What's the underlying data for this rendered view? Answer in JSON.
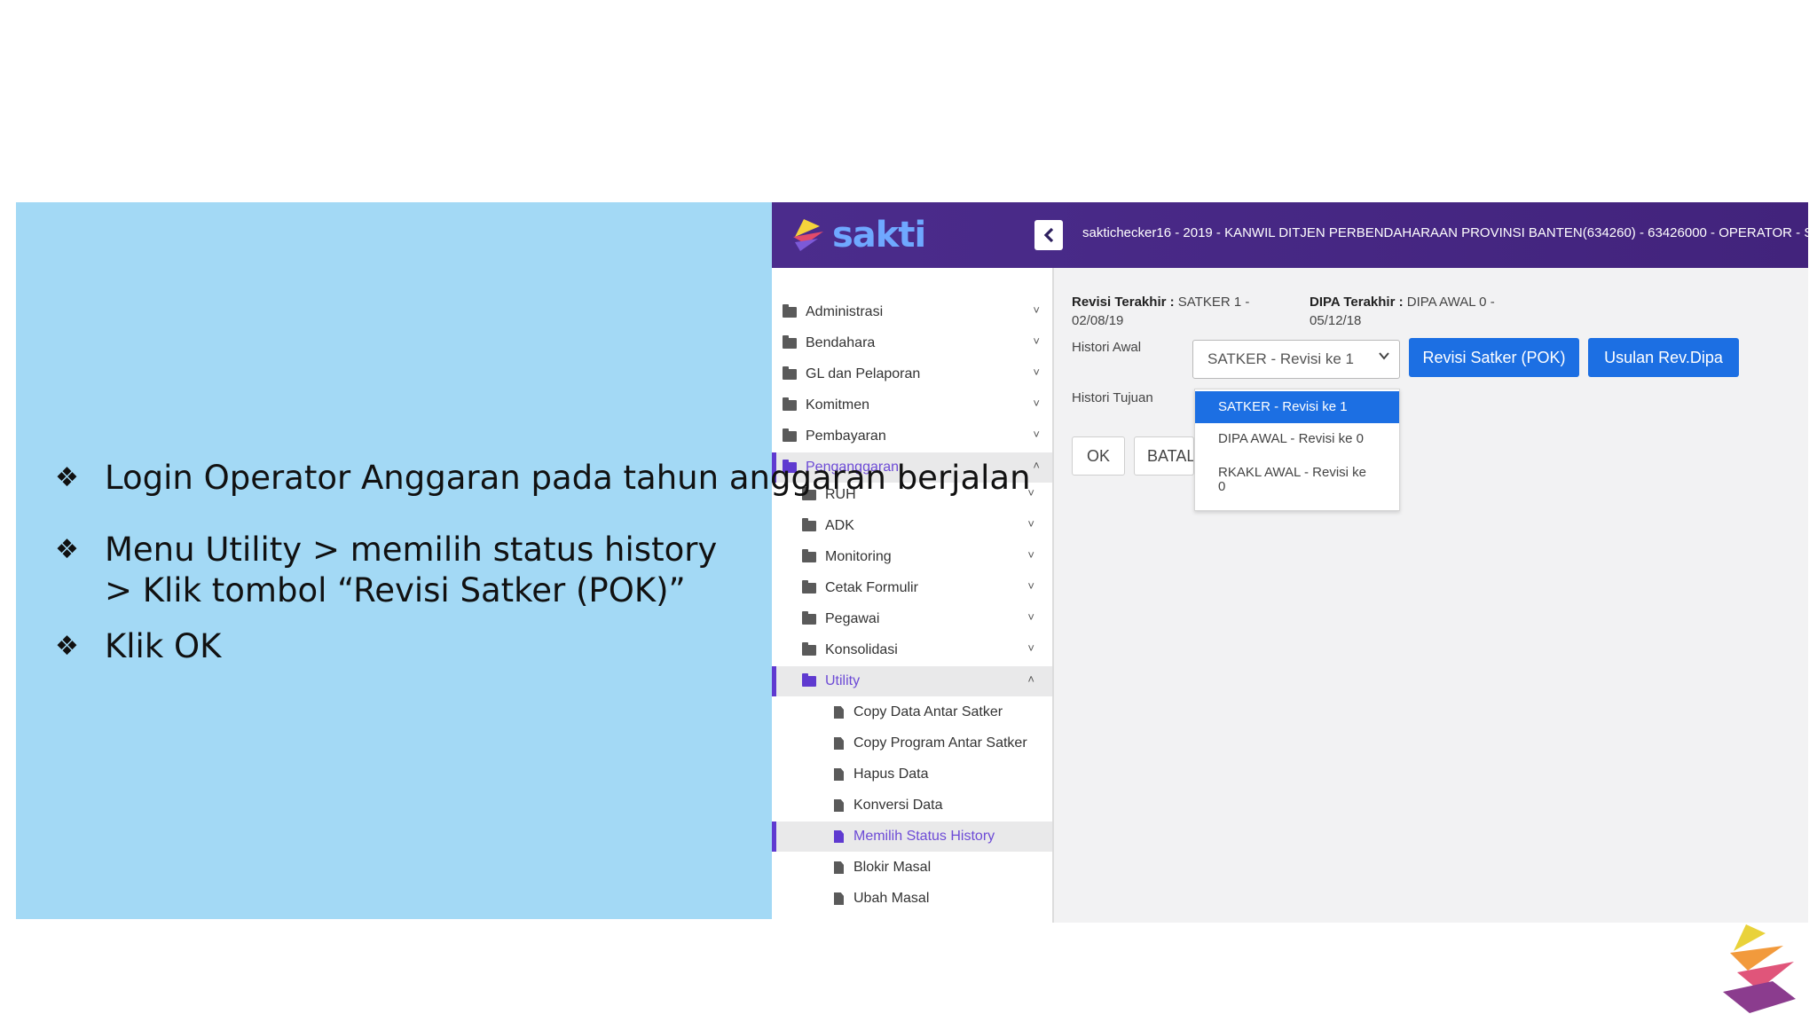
{
  "colors": {
    "panel_blue": "#a3d9f5",
    "header_purple": "#4b2c8c",
    "accent_purple": "#5f3ad0",
    "button_blue": "#1c6fe3"
  },
  "bullets": [
    {
      "icon": "four-diamond-bullet-icon",
      "lines": [
        "Login Operator Anggaran pada tahun anggaran berjalan"
      ]
    },
    {
      "icon": "four-diamond-bullet-icon",
      "lines": [
        "Menu Utility > memilih status history",
        "> Klik tombol “Revisi Satker (POK)”"
      ]
    },
    {
      "icon": "four-diamond-bullet-icon",
      "lines": [
        "Klik OK"
      ]
    }
  ],
  "app": {
    "logo_text": "sakti",
    "header_info": "saktichecker16 - 2019 - KANWIL DITJEN PERBENDAHARAAN PROVINSI BANTEN(634260) - 63426000 - OPERATOR - SATKER -"
  },
  "sidebar": {
    "items": [
      {
        "label": "Administrasi",
        "icon": "folder-icon",
        "chevron": "˅"
      },
      {
        "label": "Bendahara",
        "icon": "folder-icon",
        "chevron": "˅"
      },
      {
        "label": "GL dan Pelaporan",
        "icon": "folder-icon",
        "chevron": "˅"
      },
      {
        "label": "Komitmen",
        "icon": "folder-icon",
        "chevron": "˅"
      },
      {
        "label": "Pembayaran",
        "icon": "folder-icon",
        "chevron": "˅"
      },
      {
        "label": "Penganggaran",
        "icon": "folder-icon",
        "chevron": "˄"
      },
      {
        "label": "RUH",
        "icon": "folder-icon",
        "chevron": "˅"
      },
      {
        "label": "ADK",
        "icon": "folder-icon",
        "chevron": "˅"
      },
      {
        "label": "Monitoring",
        "icon": "folder-icon",
        "chevron": "˅"
      },
      {
        "label": "Cetak Formulir",
        "icon": "folder-icon",
        "chevron": "˅"
      },
      {
        "label": "Pegawai",
        "icon": "folder-icon",
        "chevron": "˅"
      },
      {
        "label": "Konsolidasi",
        "icon": "folder-icon",
        "chevron": "˅"
      },
      {
        "label": "Utility",
        "icon": "folder-icon",
        "chevron": "˄"
      },
      {
        "label": "Copy Data Antar Satker",
        "icon": "document-icon"
      },
      {
        "label": "Copy Program Antar Satker",
        "icon": "document-icon"
      },
      {
        "label": "Hapus Data",
        "icon": "document-icon"
      },
      {
        "label": "Konversi Data",
        "icon": "document-icon"
      },
      {
        "label": "Memilih Status History",
        "icon": "document-icon"
      },
      {
        "label": "Blokir Masal",
        "icon": "document-icon"
      },
      {
        "label": "Ubah Masal",
        "icon": "document-icon"
      }
    ]
  },
  "content": {
    "revisi_label": "Revisi Terakhir :",
    "revisi_value_1": "SATKER 1 -",
    "revisi_value_2": "02/08/19",
    "dipa_label": "DIPA Terakhir :",
    "dipa_value_1": "DIPA AWAL 0 -",
    "dipa_value_2": "05/12/18",
    "histori_awal_label": "Histori Awal",
    "histori_tujuan_label": "Histori Tujuan",
    "histori_awal_selected": "SATKER - Revisi ke 1",
    "dropdown_options": [
      "SATKER - Revisi ke 1",
      "DIPA AWAL - Revisi ke 0",
      "RKAKL AWAL - Revisi ke",
      "0"
    ],
    "btn_revisi_satker": "Revisi Satker (POK)",
    "btn_usulan": "Usulan Rev.Dipa",
    "btn_ok": "OK",
    "btn_batal": "BATAL"
  }
}
